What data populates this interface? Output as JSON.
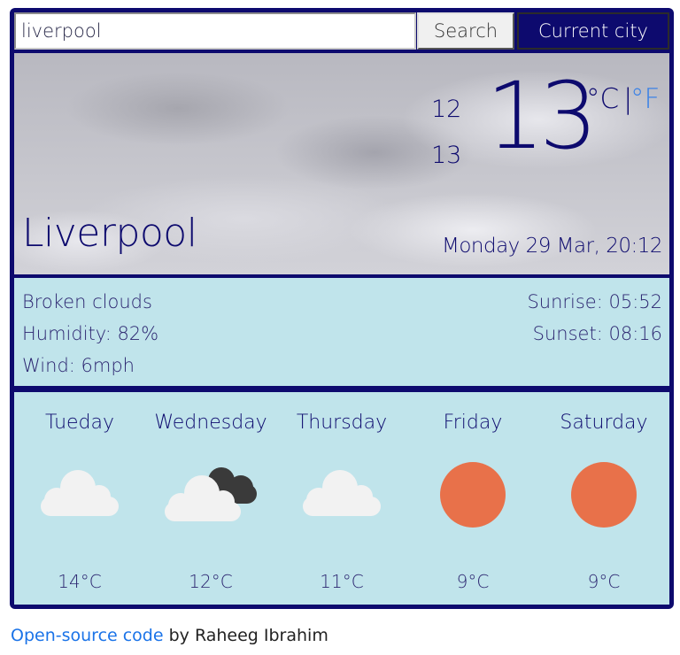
{
  "search": {
    "value": "liverpool",
    "button_label": "Search",
    "current_city_label": "Current city"
  },
  "hero": {
    "city": "Liverpool",
    "temp_max": "12",
    "temp_min": "13",
    "temp_current": "13",
    "unit_celsius": "°C",
    "unit_separator": "|",
    "unit_fahrenheit": "°F",
    "datetime": "Monday 29 Mar, 20:12"
  },
  "details": {
    "description": "Broken clouds",
    "humidity": "Humidity: 82%",
    "wind": "Wind: 6mph",
    "sunrise": "Sunrise: 05:52",
    "sunset": "Sunset: 08:16"
  },
  "forecast": [
    {
      "day": "Tueday",
      "icon": "cloud-icon",
      "temp": "14°C"
    },
    {
      "day": "Wednesday",
      "icon": "cloud-dark-cloud-icon",
      "temp": "12°C"
    },
    {
      "day": "Thursday",
      "icon": "cloud-icon",
      "temp": "11°C"
    },
    {
      "day": "Friday",
      "icon": "sun-icon",
      "temp": "9°C"
    },
    {
      "day": "Saturday",
      "icon": "sun-icon",
      "temp": "9°C"
    }
  ],
  "footer": {
    "link_text": "Open-source code",
    "author_text": " by Raheeg Ibrahim"
  },
  "colors": {
    "primary": "#0d0a6e",
    "panel": "#c0e4eb",
    "sun": "#e8714a",
    "link": "#1a73e8"
  }
}
